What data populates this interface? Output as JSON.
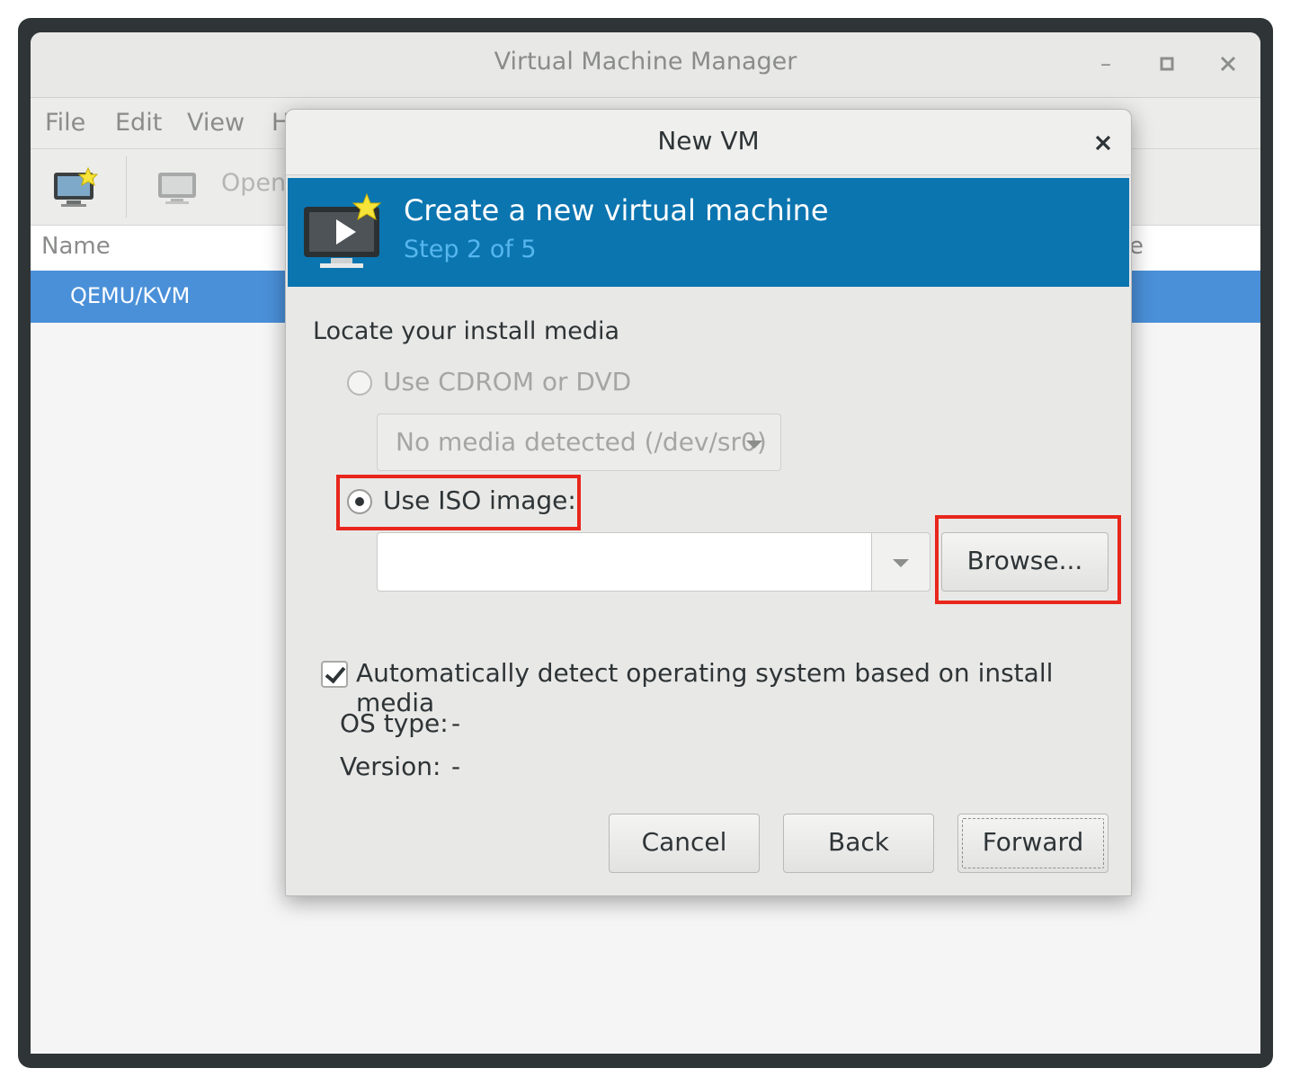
{
  "main_window": {
    "title": "Virtual Machine Manager",
    "controls": {
      "minimize": "–",
      "maximize": "□",
      "close": "×"
    },
    "menu": [
      "File",
      "Edit",
      "View",
      "H"
    ],
    "toolbar": {
      "open_label": "Open"
    },
    "list": {
      "header_name": "Name",
      "header_right": "e",
      "rows": [
        "QEMU/KVM"
      ]
    }
  },
  "dialog": {
    "title": "New VM",
    "close": "×",
    "banner": {
      "title": "Create a new virtual machine",
      "step": "Step 2 of 5"
    },
    "section_label": "Locate your install media",
    "option_cdrom": {
      "label": "Use CDROM or DVD",
      "selected": false,
      "enabled": false
    },
    "cdrom_combo": {
      "value": "No media detected (/dev/sr0)"
    },
    "option_iso": {
      "label": "Use ISO image:",
      "selected": true
    },
    "iso_path": {
      "value": "",
      "placeholder": ""
    },
    "browse_label": "Browse...",
    "autodetect": {
      "label": "Automatically detect operating system based on install media",
      "checked": true
    },
    "os_type": {
      "label": "OS type:",
      "value": "-"
    },
    "version": {
      "label": "Version:",
      "value": "-"
    },
    "buttons": {
      "cancel": "Cancel",
      "back": "Back",
      "forward": "Forward"
    }
  },
  "colors": {
    "banner_bg": "#0b75b0",
    "banner_step": "#56b6ee",
    "selection": "#4a90d9",
    "highlight": "#e8261c"
  }
}
